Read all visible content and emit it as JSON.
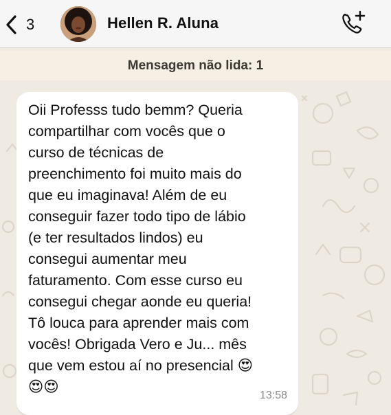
{
  "header": {
    "back_count": "3",
    "contact_name": "Hellen R. Aluna",
    "back_icon": "chevron-left-icon",
    "call_icon": "phone-add-icon"
  },
  "chat": {
    "unread_banner": "Mensagem não lida: 1",
    "message": {
      "text": "Oii Professs tudo bemm? Queria\ncompartilhar com vocês que o\ncurso de técnicas de\npreenchimento foi muito mais do\nque eu imaginava! Além de eu\nconseguir fazer todo tipo de lábio\n(e ter resultados lindos) eu\nconsegui aumentar meu\nfaturamento. Com esse curso eu\nconsegui chegar aonde eu queria!\nTô louca para aprender mais com\nvocês! Obrigada Vero e Ju... mês\nque vem estou aí no presencial 😍\n😍😍",
      "time": "13:58"
    }
  },
  "colors": {
    "header_bg": "#f6f6f6",
    "chat_bg": "#efeae2",
    "bubble_bg": "#ffffff",
    "timestamp": "#8a8a8a"
  }
}
